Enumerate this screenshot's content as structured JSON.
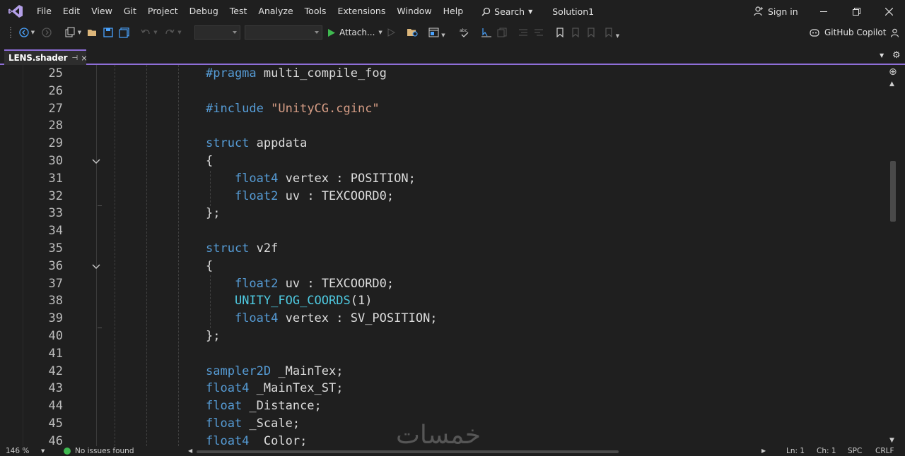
{
  "menu": [
    "File",
    "Edit",
    "View",
    "Git",
    "Project",
    "Debug",
    "Test",
    "Analyze",
    "Tools",
    "Extensions",
    "Window",
    "Help"
  ],
  "search": {
    "label": "Search"
  },
  "solution_name": "Solution1",
  "signin_label": "Sign in",
  "toolbar": {
    "attach_label": "Attach...",
    "copilot_label": "GitHub Copilot"
  },
  "tab": {
    "title": "LENS.shader"
  },
  "editor": {
    "line_numbers": [
      "25",
      "26",
      "27",
      "28",
      "29",
      "30",
      "31",
      "32",
      "33",
      "34",
      "35",
      "36",
      "37",
      "38",
      "39",
      "40",
      "41",
      "42",
      "43",
      "44",
      "45",
      "46"
    ],
    "code": [
      [
        {
          "t": "#pragma",
          "c": "pp"
        },
        {
          "t": " multi_compile_fog",
          "c": ""
        }
      ],
      [],
      [
        {
          "t": "#include",
          "c": "pp"
        },
        {
          "t": " ",
          "c": ""
        },
        {
          "t": "\"UnityCG.cginc\"",
          "c": "str"
        }
      ],
      [],
      [
        {
          "t": "struct",
          "c": "kw"
        },
        {
          "t": " appdata",
          "c": ""
        }
      ],
      [
        {
          "t": "{",
          "c": ""
        }
      ],
      [
        {
          "t": "    ",
          "c": ""
        },
        {
          "t": "float4",
          "c": "kw"
        },
        {
          "t": " vertex : POSITION;",
          "c": ""
        }
      ],
      [
        {
          "t": "    ",
          "c": ""
        },
        {
          "t": "float2",
          "c": "kw"
        },
        {
          "t": " uv : TEXCOORD0;",
          "c": ""
        }
      ],
      [
        {
          "t": "};",
          "c": ""
        }
      ],
      [],
      [
        {
          "t": "struct",
          "c": "kw"
        },
        {
          "t": " v2f",
          "c": ""
        }
      ],
      [
        {
          "t": "{",
          "c": ""
        }
      ],
      [
        {
          "t": "    ",
          "c": ""
        },
        {
          "t": "float2",
          "c": "kw"
        },
        {
          "t": " uv : TEXCOORD0;",
          "c": ""
        }
      ],
      [
        {
          "t": "    ",
          "c": ""
        },
        {
          "t": "UNITY_FOG_COORDS",
          "c": "mac"
        },
        {
          "t": "(1)",
          "c": ""
        }
      ],
      [
        {
          "t": "    ",
          "c": ""
        },
        {
          "t": "float4",
          "c": "kw"
        },
        {
          "t": " vertex : SV_POSITION;",
          "c": ""
        }
      ],
      [
        {
          "t": "};",
          "c": ""
        }
      ],
      [],
      [
        {
          "t": "sampler2D",
          "c": "kw"
        },
        {
          "t": " _MainTex;",
          "c": ""
        }
      ],
      [
        {
          "t": "float4",
          "c": "kw"
        },
        {
          "t": " _MainTex_ST;",
          "c": ""
        }
      ],
      [
        {
          "t": "float",
          "c": "kw"
        },
        {
          "t": " _Distance;",
          "c": ""
        }
      ],
      [
        {
          "t": "float",
          "c": "kw"
        },
        {
          "t": " _Scale;",
          "c": ""
        }
      ],
      [
        {
          "t": "float4",
          "c": "kw"
        },
        {
          "t": " _Color;",
          "c": ""
        }
      ]
    ]
  },
  "status": {
    "zoom": "146 %",
    "issues": "No issues found",
    "line": "Ln: 1",
    "char": "Ch: 1",
    "spacing": "SPC",
    "line_ending": "CRLF"
  },
  "watermark": "خمسات",
  "colors": {
    "accent": "#8e6ed8",
    "keyword": "#569cd6",
    "string": "#d69d85",
    "macro": "#4ec9e0",
    "ok": "#3fb950"
  }
}
